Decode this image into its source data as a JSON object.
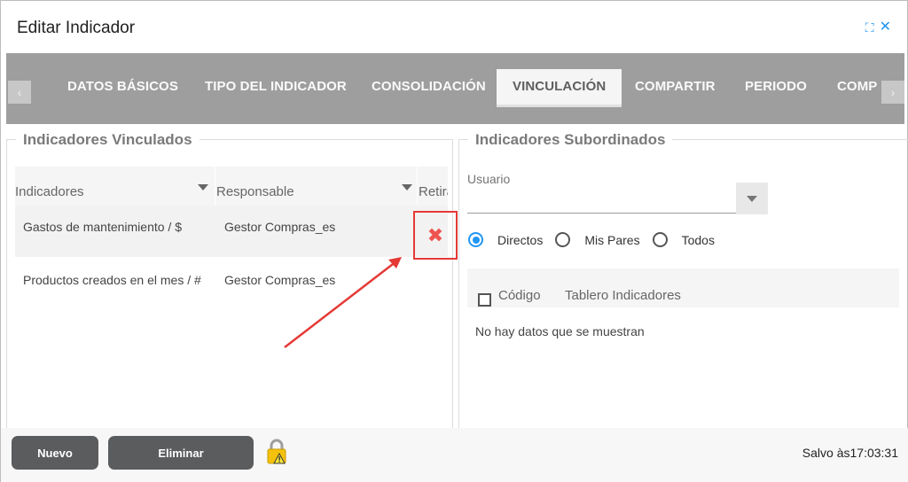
{
  "window": {
    "title": "Editar Indicador"
  },
  "tabs": [
    {
      "label": "DATOS BÁSICOS"
    },
    {
      "label": "TIPO DEL INDICADOR"
    },
    {
      "label": "CONSOLIDACIÓN"
    },
    {
      "label": "VINCULACIÓN",
      "active": true
    },
    {
      "label": "COMPARTIR"
    },
    {
      "label": "PERIODO"
    },
    {
      "label": "COMP"
    }
  ],
  "left_panel": {
    "title": "Indicadores Vinculados",
    "columns": [
      "Indicadores",
      "Responsable",
      "Retira"
    ],
    "rows": [
      {
        "indicador": "Gastos de mantenimiento / $",
        "responsable": "Gestor Compras_es"
      },
      {
        "indicador": "Productos creados en el mes / #",
        "responsable": "Gestor Compras_es"
      }
    ]
  },
  "right_panel": {
    "title": "Indicadores Subordinados",
    "usuario_label": "Usuario",
    "radio_options": [
      {
        "label": "Directos",
        "checked": true
      },
      {
        "label": "Mis Pares",
        "checked": false
      },
      {
        "label": "Todos",
        "checked": false
      }
    ],
    "columns": [
      "Código",
      "Tablero Indicadores"
    ],
    "empty_message": "No hay datos que se muestran"
  },
  "footer": {
    "new_label": "Nuevo",
    "delete_label": "Eliminar",
    "saved_status": "Salvo às17:03:31"
  },
  "colors": {
    "accent": "#2196f3",
    "tabbar": "#9e9e9e",
    "button": "#5a5c5e",
    "highlight": "#e53935"
  },
  "icons": {
    "expand": "expand-icon",
    "close": "close-icon",
    "remove": "remove-x-icon",
    "lock": "lock-warning-icon"
  }
}
